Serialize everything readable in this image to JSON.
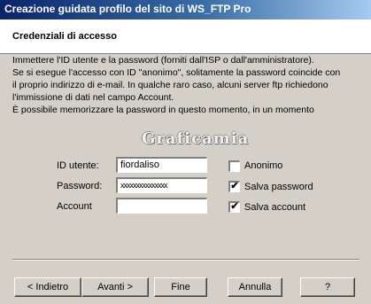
{
  "window": {
    "title": "Creazione guidata profilo del sito di WS_FTP Pro"
  },
  "header": {
    "title": "Credenziali di accesso"
  },
  "body_lines": [
    "Immettere l'ID utente e la password (forniti dall'ISP o dall'amministratore).",
    "Se si esegue l'accesso con ID \"anonimo\", solitamente la password coincide con",
    "il proprio indirizzo di e-mail. In qualche raro caso, alcuni server ftp richiedono",
    "l'immissione di dati nel campo Account.",
    "È possibile memorizzare la password in questo momento, in un momento"
  ],
  "logo": {
    "text": "Graficamia"
  },
  "form": {
    "user_label": "ID utente:",
    "user_value": "fiordaliso",
    "password_label": "Password:",
    "password_value": "xxxxxxxxxxxxxxx",
    "account_label": "Account",
    "account_value": ""
  },
  "options": {
    "anonymous": {
      "label": "Anonimo",
      "checked": false
    },
    "save_password": {
      "label": "Salva password",
      "checked": true
    },
    "save_account": {
      "label": "Salva account",
      "checked": true
    },
    "check_glyph": "✔"
  },
  "buttons": {
    "back": "< Indietro",
    "next": "Avanti >",
    "finish": "Fine",
    "cancel": "Annulla",
    "help": "?"
  }
}
